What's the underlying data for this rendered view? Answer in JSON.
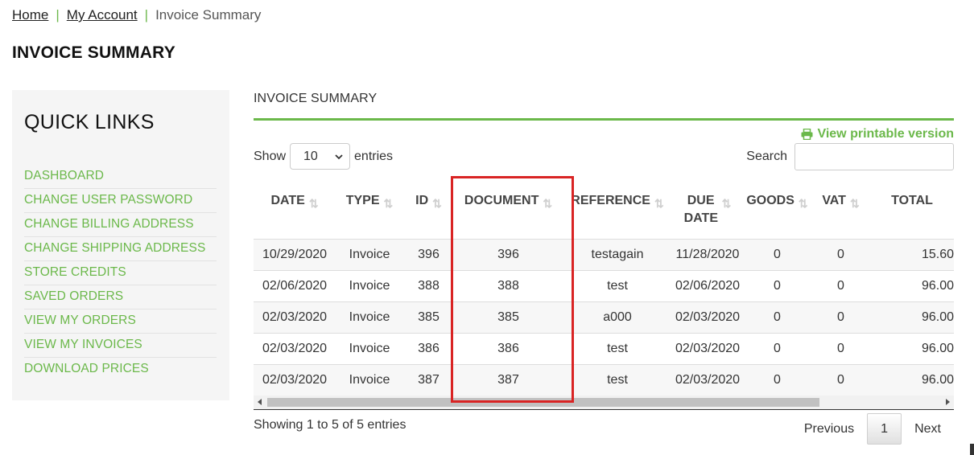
{
  "breadcrumb": {
    "home": "Home",
    "sep": "|",
    "account": "My Account",
    "current": "Invoice Summary"
  },
  "page_title": "INVOICE SUMMARY",
  "sidebar": {
    "title": "QUICK LINKS",
    "items": [
      {
        "label": "DASHBOARD"
      },
      {
        "label": "CHANGE USER PASSWORD"
      },
      {
        "label": "CHANGE BILLING ADDRESS"
      },
      {
        "label": "CHANGE SHIPPING ADDRESS"
      },
      {
        "label": "STORE CREDITS"
      },
      {
        "label": "SAVED ORDERS"
      },
      {
        "label": "VIEW MY ORDERS"
      },
      {
        "label": "VIEW MY INVOICES"
      },
      {
        "label": "DOWNLOAD PRICES"
      }
    ]
  },
  "main": {
    "section_title": "INVOICE SUMMARY",
    "print_link": "View printable version",
    "print_icon": "printer-icon",
    "length": {
      "show": "Show",
      "value": "10",
      "entries": "entries"
    },
    "search": {
      "label": "Search",
      "value": ""
    },
    "columns": [
      "DATE",
      "TYPE",
      "ID",
      "DOCUMENT",
      "REFERENCE",
      "DUE DATE",
      "GOODS",
      "VAT",
      "TOTAL"
    ],
    "rows": [
      {
        "date": "10/29/2020",
        "type": "Invoice",
        "id": "396",
        "document": "396",
        "reference": "testagain",
        "due": "11/28/2020",
        "goods": "0",
        "vat": "0",
        "total": "15.60"
      },
      {
        "date": "02/06/2020",
        "type": "Invoice",
        "id": "388",
        "document": "388",
        "reference": "test",
        "due": "02/06/2020",
        "goods": "0",
        "vat": "0",
        "total": "96.00"
      },
      {
        "date": "02/03/2020",
        "type": "Invoice",
        "id": "385",
        "document": "385",
        "reference": "a000",
        "due": "02/03/2020",
        "goods": "0",
        "vat": "0",
        "total": "96.00"
      },
      {
        "date": "02/03/2020",
        "type": "Invoice",
        "id": "386",
        "document": "386",
        "reference": "test",
        "due": "02/03/2020",
        "goods": "0",
        "vat": "0",
        "total": "96.00"
      },
      {
        "date": "02/03/2020",
        "type": "Invoice",
        "id": "387",
        "document": "387",
        "reference": "test",
        "due": "02/03/2020",
        "goods": "0",
        "vat": "0",
        "total": "96.00"
      }
    ],
    "info": "Showing 1 to 5 of 5 entries",
    "pagination": {
      "previous": "Previous",
      "current": "1",
      "next": "Next"
    }
  },
  "colors": {
    "accent": "#6bb84a",
    "highlight": "#d92424"
  }
}
